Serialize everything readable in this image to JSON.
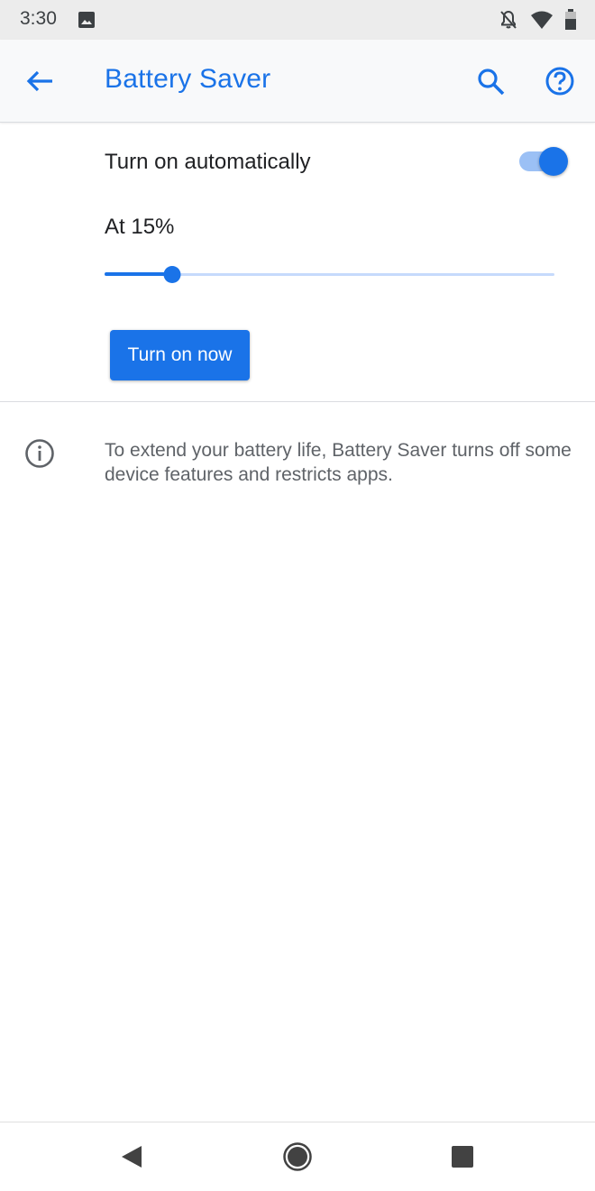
{
  "status_bar": {
    "time": "3:30",
    "icons": [
      "image-icon",
      "notifications-off-icon",
      "wifi-icon",
      "battery-icon"
    ]
  },
  "app_bar": {
    "title": "Battery Saver",
    "icons": [
      "back-arrow-icon",
      "search-icon",
      "help-icon"
    ]
  },
  "settings": {
    "auto_label": "Turn on automatically",
    "auto_enabled": true,
    "threshold_label": "At 15%",
    "threshold_percent": 15,
    "turn_on_now_label": "Turn on now"
  },
  "info": {
    "icon": "info-icon",
    "text": "To extend your battery life, Battery Saver turns off some device features and restricts apps."
  },
  "nav_bar": {
    "icons": [
      "nav-back-icon",
      "nav-home-icon",
      "nav-recents-icon"
    ]
  },
  "colors": {
    "accent": "#1a73e8",
    "accent_light": "#9bc0f5",
    "status_bar_bg": "#ececec",
    "app_bar_bg": "#f8f9fa",
    "secondary_text": "#5f6368"
  }
}
